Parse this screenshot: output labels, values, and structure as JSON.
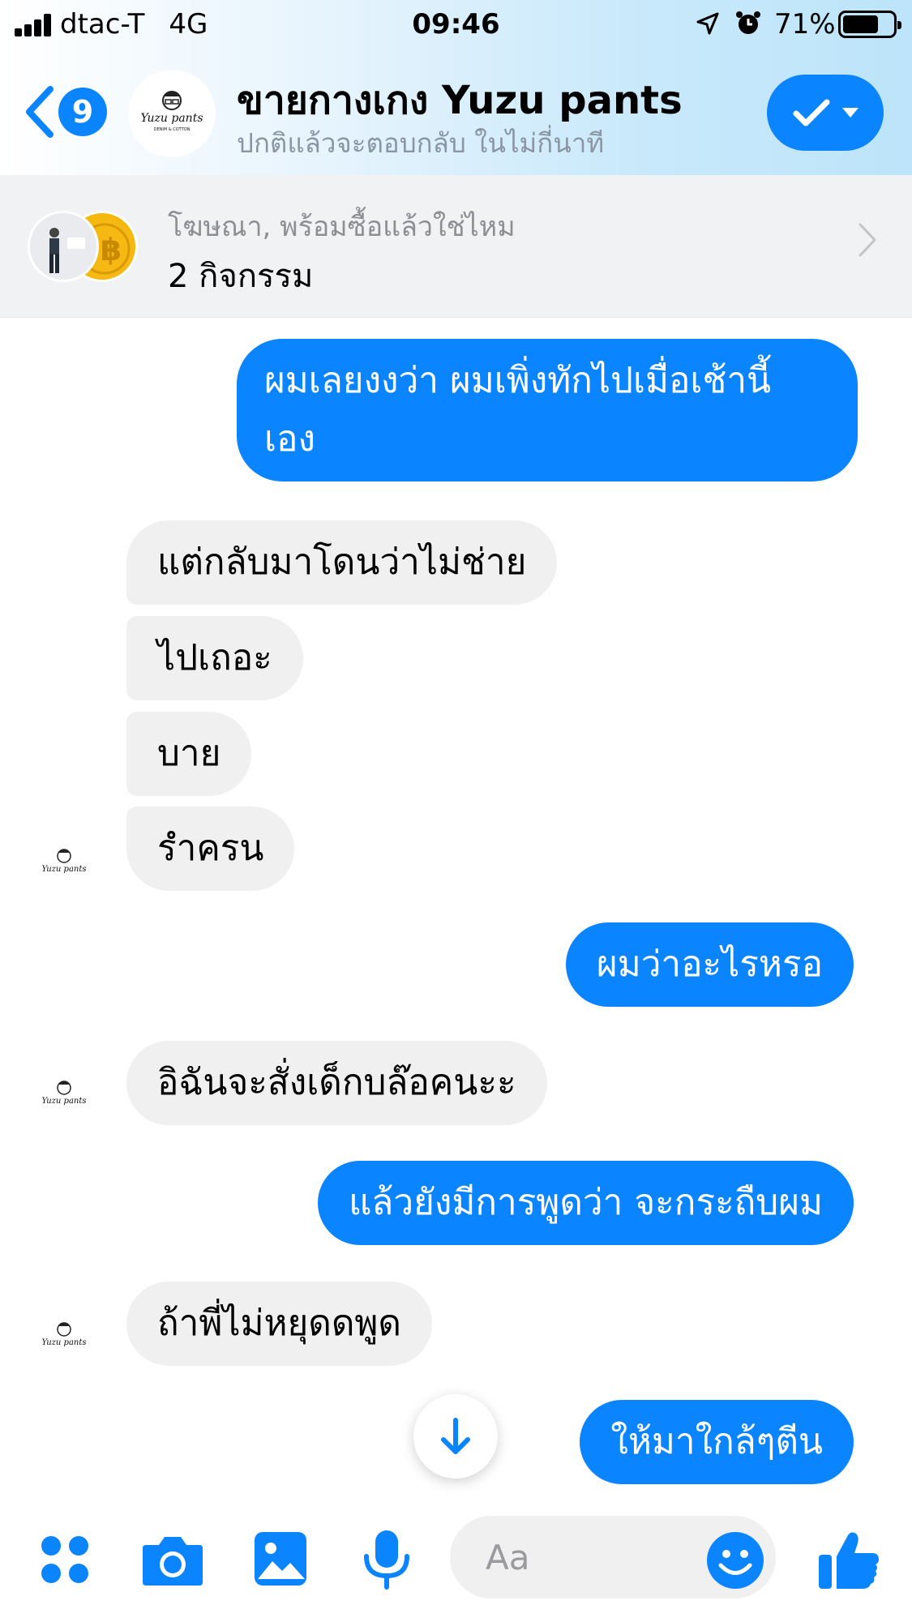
{
  "status_bar": {
    "carrier": "dtac-T",
    "network": "4G",
    "time": "09:46",
    "battery": "71%",
    "battery_level": 0.71,
    "icons": [
      "signal-icon",
      "location-arrow-icon",
      "alarm-icon",
      "battery-icon"
    ]
  },
  "header": {
    "back_badge": "9",
    "title": "ขายกางเกง Yuzu pants",
    "subtitle": "ปกติแล้วจะตอบกลับ ในไม่กี่นาที",
    "logo_text": "Yuzu pants",
    "logo_sub": "DENIM & COTTON"
  },
  "ad": {
    "label": "โฆษณา, พร้อมซื้อแล้วใช่ไหม",
    "count": "2 กิจกรรม"
  },
  "messages": [
    {
      "from": "me",
      "line1": "ผมเลยงงว่า ผมเพิ่งทักไปเมื่อเช้านี้",
      "line2": "เอง"
    },
    {
      "from": "page",
      "text": "แต่กลับมาโดนว่าไม่ช่าย"
    },
    {
      "from": "page",
      "text": "ไปเถอะ"
    },
    {
      "from": "page",
      "text": "บาย"
    },
    {
      "from": "page",
      "text": "รำครน"
    },
    {
      "from": "me",
      "text": "ผมว่าอะไรหรอ"
    },
    {
      "from": "page",
      "text": "อิฉันจะสั่งเด็กบล๊อคนะะ"
    },
    {
      "from": "me",
      "text": "แล้วยังมีการพูดว่า จะกระถืบผม"
    },
    {
      "from": "page",
      "text": "ถ้าพี่ไม่หยุดดพูด"
    },
    {
      "from": "me",
      "text": "ให้มาใกล้ๆตีน"
    }
  ],
  "composer": {
    "placeholder": "Aa",
    "icons": [
      "apps-icon",
      "camera-icon",
      "photo-icon",
      "microphone-icon",
      "emoji-icon",
      "thumbs-up-icon"
    ]
  },
  "colors": {
    "accent": "#0a84ff",
    "incoming_bubble": "#f0f0f0",
    "header_gradient_end": "#bde4fa"
  }
}
